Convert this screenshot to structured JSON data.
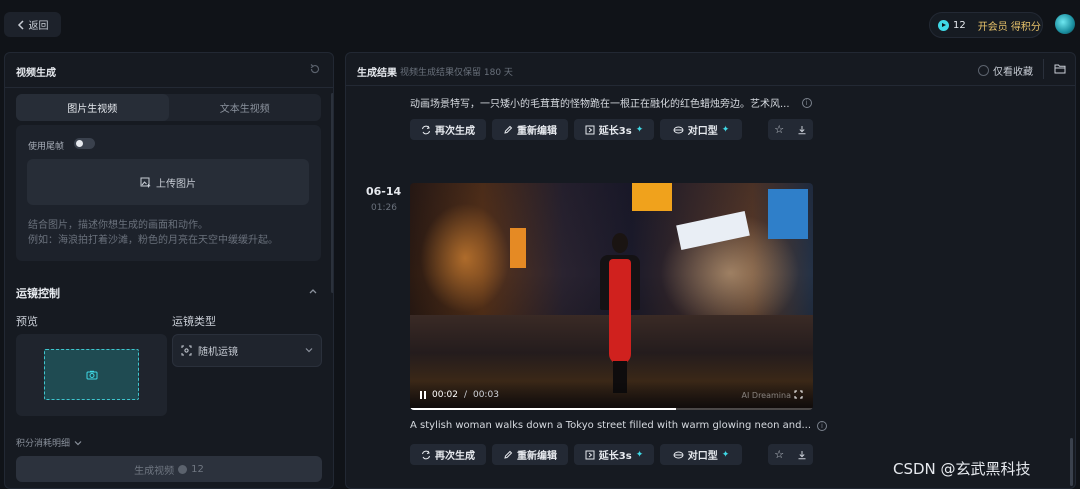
{
  "topbar": {
    "back_label": "返回",
    "credits": "12",
    "vip_label": "开会员 得积分"
  },
  "left": {
    "title": "视频生成",
    "tabs": [
      {
        "label": "图片生视频",
        "active": true
      },
      {
        "label": "文本生视频",
        "active": false
      }
    ],
    "tailframe_label": "使用尾帧",
    "tailframe_enabled": false,
    "upload_label": "上传图片",
    "prompt_hint_1": "结合图片，描述你想生成的画面和动作。",
    "prompt_hint_2": "例如：海浪拍打着沙滩，粉色的月亮在天空中缓缓升起。",
    "camera_section": "运镜控制",
    "preview_label": "预览",
    "camera_type_label": "运镜类型",
    "camera_type_value": "随机运镜",
    "cost_detail": "积分消耗明细",
    "generate_label": "生成视频",
    "generate_cost": "12"
  },
  "right": {
    "title": "生成结果",
    "note": "视频生成结果仅保留 180 天",
    "fav_only": "仅看收藏",
    "items": [
      {
        "prompt": "动画场景特写，一只矮小的毛茸茸的怪物跪在一根正在融化的红色蜡烛旁边。艺术风...",
        "actions": {
          "regen": "再次生成",
          "reedit": "重新编辑",
          "extend": "延长3s",
          "lipsync": "对口型"
        }
      },
      {
        "date": "06-14",
        "time": "01:26",
        "video": {
          "current": "00:02",
          "separator": "/",
          "duration": "00:03",
          "progress": 0.66,
          "watermark": "AI Dreamina"
        },
        "prompt": "A stylish woman walks down a Tokyo street filled with warm glowing neon and...",
        "actions": {
          "regen": "再次生成",
          "reedit": "重新编辑",
          "extend": "延长3s",
          "lipsync": "对口型"
        }
      }
    ]
  },
  "watermark": "CSDN @玄武黑科技",
  "colors": {
    "accent": "#3fd9e6",
    "vip": "#e7c26a",
    "background": "#101318"
  }
}
